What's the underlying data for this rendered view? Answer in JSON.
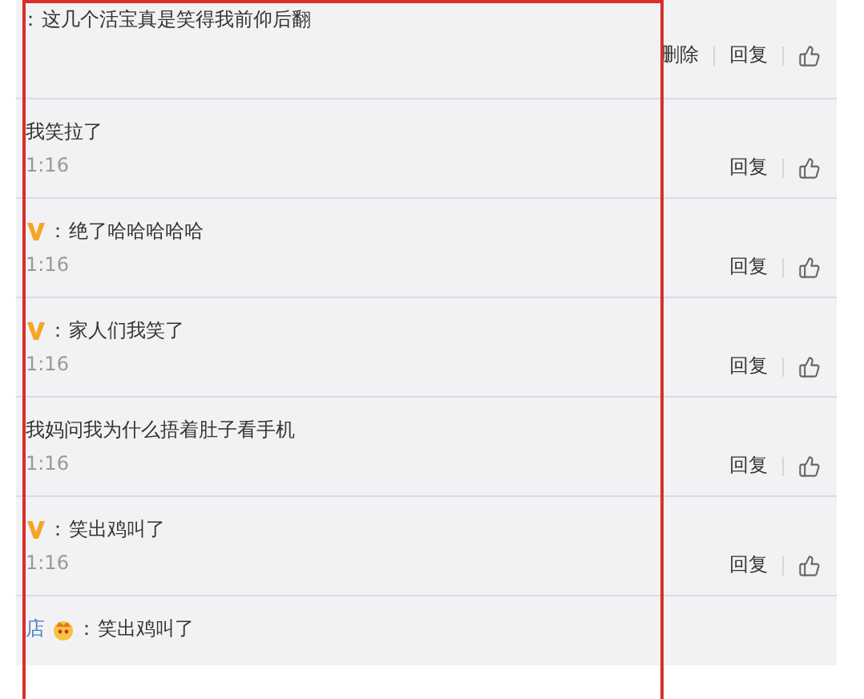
{
  "comments": [
    {
      "separator": "：",
      "text": "这几个活宝真是笑得我前仰后翻",
      "actions": [
        "删除",
        "回复"
      ]
    },
    {
      "text": "我笑拉了",
      "time": "1:16",
      "actions": [
        "回复"
      ]
    },
    {
      "vip": true,
      "separator": "：",
      "text": "绝了哈哈哈哈哈",
      "time": "1:16",
      "actions": [
        "回复"
      ]
    },
    {
      "vip": true,
      "separator": "：",
      "text": "家人们我笑了",
      "time": "1:16",
      "actions": [
        "回复"
      ]
    },
    {
      "text": "我妈问我为什么捂着肚子看手机",
      "time": "1:16",
      "actions": [
        "回复"
      ]
    },
    {
      "vip": true,
      "separator": "：",
      "text": "笑出鸡叫了",
      "time": "1:16",
      "actions": [
        "回复"
      ]
    },
    {
      "author": "店",
      "crown": true,
      "separator": "：",
      "text": "笑出鸡叫了"
    }
  ]
}
